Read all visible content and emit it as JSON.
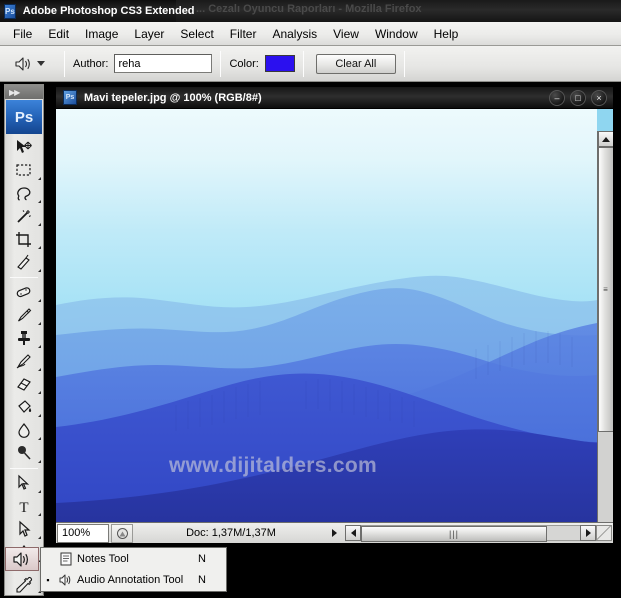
{
  "background_window": {
    "title": "... Cezalı Oyuncu Raporları - Mozilla Firefox"
  },
  "app": {
    "title": "Adobe Photoshop CS3 Extended",
    "logo_text": "Ps"
  },
  "menubar": {
    "items": [
      {
        "label": "File"
      },
      {
        "label": "Edit"
      },
      {
        "label": "Image"
      },
      {
        "label": "Layer"
      },
      {
        "label": "Select"
      },
      {
        "label": "Filter"
      },
      {
        "label": "Analysis"
      },
      {
        "label": "View"
      },
      {
        "label": "Window"
      },
      {
        "label": "Help"
      }
    ]
  },
  "options_bar": {
    "tool_preset_icon": "speaker-icon",
    "author_label": "Author:",
    "author_value": "reha",
    "author_placeholder": "",
    "color_label": "Color:",
    "color_value": "#2b10ef",
    "clear_all_label": "Clear All"
  },
  "toolbox": {
    "collapse_arrows": "▶▶",
    "logo_text": "Ps",
    "tools": [
      {
        "name": "move-tool",
        "has_flyout": false
      },
      {
        "name": "rectangular-marquee-tool",
        "has_flyout": true
      },
      {
        "name": "lasso-tool",
        "has_flyout": true
      },
      {
        "name": "magic-wand-tool",
        "has_flyout": true
      },
      {
        "name": "crop-tool",
        "has_flyout": true
      },
      {
        "name": "slice-tool",
        "has_flyout": true
      },
      {
        "name": "healing-brush-tool",
        "has_flyout": true
      },
      {
        "name": "brush-tool",
        "has_flyout": true
      },
      {
        "name": "clone-stamp-tool",
        "has_flyout": true
      },
      {
        "name": "history-brush-tool",
        "has_flyout": true
      },
      {
        "name": "eraser-tool",
        "has_flyout": true
      },
      {
        "name": "paint-bucket-tool",
        "has_flyout": true
      },
      {
        "name": "blur-tool",
        "has_flyout": true
      },
      {
        "name": "dodge-tool",
        "has_flyout": true
      },
      {
        "name": "pen-tool",
        "has_flyout": true
      },
      {
        "name": "type-tool",
        "has_flyout": true
      },
      {
        "name": "path-selection-tool",
        "has_flyout": true
      },
      {
        "name": "shape-tool",
        "has_flyout": true
      }
    ]
  },
  "document_window": {
    "title": "Mavi tepeler.jpg @ 100% (RGB/8#)",
    "icon": "photoshop-document-icon",
    "minimize_label": "–",
    "maximize_label": "□",
    "close_label": "×",
    "watermark": "www.dijitalders.com",
    "status": {
      "zoom_value": "100%",
      "doc_info": "Doc: 1,37M/1,37M"
    },
    "scrollbars": {
      "vertical_up": "up-arrow-icon",
      "vertical_down": "down-arrow-icon",
      "horizontal_left": "left-arrow-icon",
      "horizontal_right": "right-arrow-icon",
      "thumb_grip": "‖"
    }
  },
  "flyout_menu": {
    "items": [
      {
        "label": "Notes Tool",
        "shortcut": "N",
        "selected": false,
        "icon": "note-icon",
        "bullet": ""
      },
      {
        "label": "Audio Annotation Tool",
        "shortcut": "N",
        "selected": true,
        "icon": "speaker-icon",
        "bullet": "▪"
      }
    ]
  },
  "image_colors": {
    "sky_top": "#e9f8fc",
    "sky_mid": "#b0e6f7",
    "sky_bottom": "#7ed2ef",
    "ridge_far": "#8cc4ec",
    "ridge_mid": "#6a9ee6",
    "ridge_near": "#4a6fdc",
    "ridge_fore": "#3348c8",
    "ridge_dark": "#2a3ab0"
  }
}
